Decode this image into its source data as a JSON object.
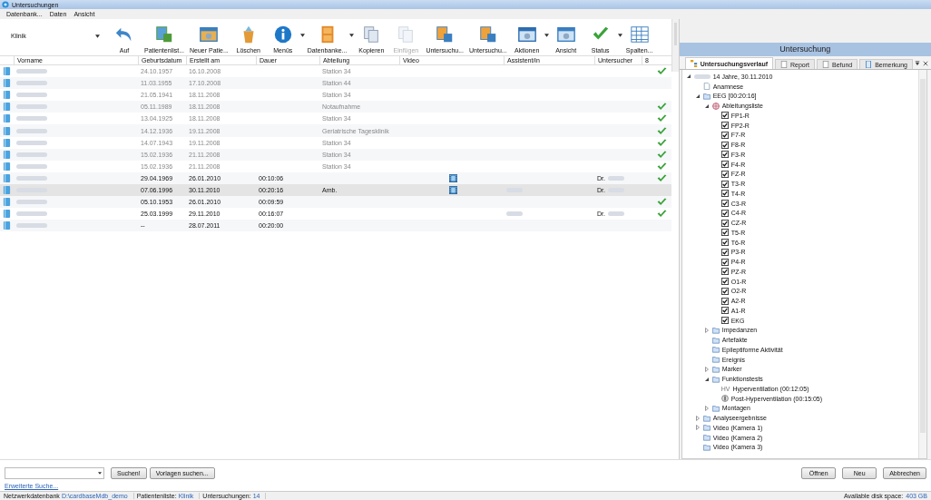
{
  "window": {
    "title": "Untersuchungen"
  },
  "menu": [
    "Datenbank...",
    "Daten",
    "Ansicht"
  ],
  "toolbar": {
    "selector": "Klinik",
    "buttons": [
      {
        "label": "Auf",
        "dropdown": false,
        "disabled": false
      },
      {
        "label": "Patientenlist...",
        "dropdown": false,
        "disabled": false
      },
      {
        "label": "Neuer Patie...",
        "dropdown": false,
        "disabled": false
      },
      {
        "label": "Löschen",
        "dropdown": false,
        "disabled": false
      },
      {
        "label": "Menüs",
        "dropdown": true,
        "disabled": false
      },
      {
        "label": "Datenbanke...",
        "dropdown": true,
        "disabled": false
      },
      {
        "label": "Kopieren",
        "dropdown": false,
        "disabled": false
      },
      {
        "label": "Einfügen",
        "dropdown": false,
        "disabled": true
      },
      {
        "label": "Untersuchu...",
        "dropdown": false,
        "disabled": false
      },
      {
        "label": "Untersuchu...",
        "dropdown": false,
        "disabled": false
      },
      {
        "label": "Aktionen",
        "dropdown": true,
        "disabled": false
      },
      {
        "label": "Ansicht",
        "dropdown": false,
        "disabled": false
      },
      {
        "label": "Status",
        "dropdown": true,
        "disabled": false
      },
      {
        "label": "Spalten...",
        "dropdown": false,
        "disabled": false
      }
    ]
  },
  "table": {
    "columns": [
      "Vorname",
      "Geburtsdatum",
      "Erstellt am",
      "Dauer",
      "Abteilung",
      "Video",
      "Assistent/in",
      "Untersucher",
      "8"
    ],
    "rows": [
      {
        "name_blurred": true,
        "born": "24.10.1957",
        "created": "16.10.2008",
        "dept": "Station 34",
        "video": false,
        "assistant_blurred": false,
        "done": true,
        "dimmed": true,
        "selected": false
      },
      {
        "name_blurred": true,
        "born": "11.03.1955",
        "created": "17.10.2008",
        "dept": "Station 44",
        "video": false,
        "assistant_blurred": false,
        "done": false,
        "dimmed": true,
        "selected": false
      },
      {
        "name_blurred": true,
        "born": "21.05.1941",
        "created": "18.11.2008",
        "dept": "Station 34",
        "video": false,
        "assistant_blurred": false,
        "done": false,
        "dimmed": true,
        "selected": false
      },
      {
        "name_blurred": true,
        "born": "05.11.1989",
        "created": "18.11.2008",
        "dept": "Notaufnahme",
        "video": false,
        "assistant_blurred": false,
        "done": true,
        "dimmed": true,
        "selected": false
      },
      {
        "name_blurred": true,
        "born": "13.04.1925",
        "created": "18.11.2008",
        "dept": "Station 34",
        "video": false,
        "assistant_blurred": false,
        "done": true,
        "dimmed": true,
        "selected": false
      },
      {
        "name_blurred": true,
        "born": "14.12.1936",
        "created": "19.11.2008",
        "dept": "Geriatrische Tagesklinik",
        "video": false,
        "assistant_blurred": false,
        "done": true,
        "dimmed": true,
        "selected": false
      },
      {
        "name_blurred": true,
        "born": "14.07.1943",
        "created": "19.11.2008",
        "dept": "Station 34",
        "video": false,
        "assistant_blurred": false,
        "done": true,
        "dimmed": true,
        "selected": false
      },
      {
        "name_blurred": true,
        "born": "15.02.1936",
        "created": "21.11.2008",
        "dept": "Station 34",
        "video": false,
        "assistant_blurred": false,
        "done": true,
        "dimmed": true,
        "selected": false
      },
      {
        "name_blurred": true,
        "born": "15.02.1936",
        "created": "21.11.2008",
        "dept": "Station 34",
        "video": false,
        "assistant_blurred": false,
        "done": true,
        "dimmed": true,
        "selected": false
      },
      {
        "name_blurred": true,
        "born": "29.04.1969",
        "created": "26.01.2010",
        "duration": "00:10:06",
        "video": true,
        "assistant_blurred": false,
        "examiner": "Dr.",
        "done": true,
        "dimmed": false,
        "selected": false
      },
      {
        "name_blurred": true,
        "born": "07.06.1996",
        "created": "30.11.2010",
        "duration": "00:20:16",
        "dept": "Amb.",
        "video": true,
        "assistant_blurred": true,
        "examiner": "Dr.",
        "done": false,
        "dimmed": false,
        "selected": true
      },
      {
        "name_blurred": true,
        "born": "05.10.1953",
        "created": "26.01.2010",
        "duration": "00:09:59",
        "video": false,
        "assistant_blurred": false,
        "done": true,
        "dimmed": false,
        "selected": false
      },
      {
        "name_blurred": true,
        "born": "25.03.1999",
        "created": "29.11.2010",
        "duration": "00:16:07",
        "video": false,
        "assistant_blurred": true,
        "examiner": "Dr.",
        "done": true,
        "dimmed": false,
        "selected": false
      },
      {
        "name_blurred": true,
        "born": "--",
        "created": "28.07.2011",
        "duration": "00:20:00",
        "video": false,
        "assistant_blurred": false,
        "done": false,
        "dimmed": false,
        "selected": false
      }
    ]
  },
  "panel": {
    "title": "Untersuchung",
    "tabs": [
      {
        "label": "Untersuchungsverlauf",
        "selected": true
      },
      {
        "label": "Report",
        "selected": false
      },
      {
        "label": "Befund",
        "selected": false
      },
      {
        "label": "Bemerkung",
        "selected": false
      }
    ],
    "tree": [
      {
        "label": "14 Jahre, 30.11.2010",
        "kind": "patient",
        "expanded": true,
        "children": [
          {
            "label": "Anamnese",
            "kind": "doc"
          },
          {
            "label": "EEG [00:20:16]",
            "kind": "folder",
            "expanded": true,
            "children": [
              {
                "label": "Ableitungsliste",
                "kind": "montage",
                "expanded": true,
                "children": [
                  {
                    "label": "FP1-R",
                    "kind": "check",
                    "checked": true
                  },
                  {
                    "label": "FP2-R",
                    "kind": "check",
                    "checked": true
                  },
                  {
                    "label": "F7-R",
                    "kind": "check",
                    "checked": true
                  },
                  {
                    "label": "F8-R",
                    "kind": "check",
                    "checked": true
                  },
                  {
                    "label": "F3-R",
                    "kind": "check",
                    "checked": true
                  },
                  {
                    "label": "F4-R",
                    "kind": "check",
                    "checked": true
                  },
                  {
                    "label": "FZ-R",
                    "kind": "check",
                    "checked": true
                  },
                  {
                    "label": "T3-R",
                    "kind": "check",
                    "checked": true
                  },
                  {
                    "label": "T4-R",
                    "kind": "check",
                    "checked": true
                  },
                  {
                    "label": "C3-R",
                    "kind": "check",
                    "checked": true
                  },
                  {
                    "label": "C4-R",
                    "kind": "check",
                    "checked": true
                  },
                  {
                    "label": "CZ-R",
                    "kind": "check",
                    "checked": true
                  },
                  {
                    "label": "T5-R",
                    "kind": "check",
                    "checked": true
                  },
                  {
                    "label": "T6-R",
                    "kind": "check",
                    "checked": true
                  },
                  {
                    "label": "P3-R",
                    "kind": "check",
                    "checked": true
                  },
                  {
                    "label": "P4-R",
                    "kind": "check",
                    "checked": true
                  },
                  {
                    "label": "PZ-R",
                    "kind": "check",
                    "checked": true
                  },
                  {
                    "label": "O1-R",
                    "kind": "check",
                    "checked": true
                  },
                  {
                    "label": "O2-R",
                    "kind": "check",
                    "checked": true
                  },
                  {
                    "label": "A2-R",
                    "kind": "check",
                    "checked": true
                  },
                  {
                    "label": "A1-R",
                    "kind": "check",
                    "checked": true
                  },
                  {
                    "label": "EKG",
                    "kind": "check",
                    "checked": true
                  }
                ]
              },
              {
                "label": "Impedanzen",
                "kind": "folder",
                "expanded": false
              },
              {
                "label": "Artefakte",
                "kind": "folder"
              },
              {
                "label": "Epileptiforme Aktivität",
                "kind": "folder"
              },
              {
                "label": "Ereignis",
                "kind": "folder"
              },
              {
                "label": "Marker",
                "kind": "folder",
                "expanded": false
              },
              {
                "label": "Funktionstests",
                "kind": "folder",
                "expanded": true,
                "children": [
                  {
                    "label": "Hyperventilation (00:12:05)",
                    "kind": "hv",
                    "badge": "HV"
                  },
                  {
                    "label": "Post-Hyperventilation (00:15:05)",
                    "kind": "timer"
                  }
                ]
              },
              {
                "label": "Montagen",
                "kind": "folder",
                "expanded": false
              }
            ]
          },
          {
            "label": "Analyseergebnisse",
            "kind": "folder",
            "expanded": false
          },
          {
            "label": "Video (Kamera 1)",
            "kind": "folder",
            "expanded": false
          },
          {
            "label": "Video (Kamera 2)",
            "kind": "folder"
          },
          {
            "label": "Video (Kamera 3)",
            "kind": "folder"
          }
        ]
      }
    ]
  },
  "search": {
    "buttons": [
      "Suchen!",
      "Vorlagen suchen..."
    ],
    "link": "Erweiterte Suche..."
  },
  "actions": [
    "Öffnen",
    "Neu",
    "Abbrechen"
  ],
  "status_bar": [
    {
      "label": "Netzwerkdatenbank",
      "value": "D:\\cardbaseMdb_demo"
    },
    {
      "label": "Patientenliste:",
      "value": "Klinik"
    },
    {
      "label": "Untersuchungen:",
      "value": "14"
    }
  ],
  "disk": {
    "label": "Available disk space:",
    "value": "403 GB"
  }
}
